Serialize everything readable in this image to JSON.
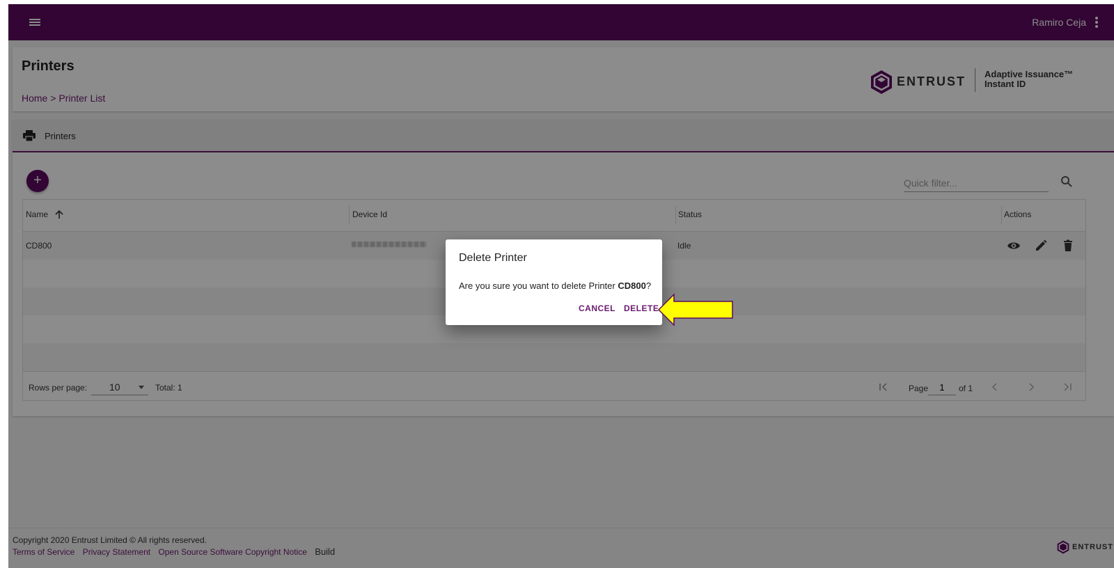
{
  "topbar": {
    "user_name": "Ramiro Ceja"
  },
  "header": {
    "title": "Printers",
    "breadcrumb": {
      "home": "Home",
      "separator": " > ",
      "current": "Printer List"
    },
    "logo": {
      "brand": "ENTRUST",
      "product_line1": "Adaptive Issuance™",
      "product_line2": "Instant ID"
    }
  },
  "panel": {
    "title": "Printers",
    "add_symbol": "+",
    "filter_placeholder": "Quick filter...",
    "columns": [
      "Name",
      "Device Id",
      "Status",
      "Actions"
    ],
    "rows": [
      {
        "name": "CD800",
        "device_id": "",
        "status": "Idle"
      }
    ],
    "pagination": {
      "rows_per_page_label": "Rows per page:",
      "rows_per_page": "10",
      "total": "Total: 1",
      "page_label": "Page",
      "page": "1",
      "of": "of 1"
    }
  },
  "footer": {
    "copyright": "Copyright 2020 Entrust Limited © All rights reserved.",
    "links": [
      "Terms of Service",
      "Privacy Statement",
      "Open Source Software Copyright Notice"
    ],
    "build": "Build",
    "logo_word": "ENTRUST"
  },
  "dialog": {
    "title": "Delete Printer",
    "message_prefix": "Are you sure you want to delete Printer ",
    "printer_name": "CD800",
    "message_suffix": "?",
    "cancel_label": "CANCEL",
    "delete_label": "DELETE"
  },
  "colors": {
    "brand": "#5c0a5f",
    "accent": "#6a1a6e",
    "arrow_fill": "#ffff00",
    "arrow_stroke": "#5c0a5f"
  }
}
